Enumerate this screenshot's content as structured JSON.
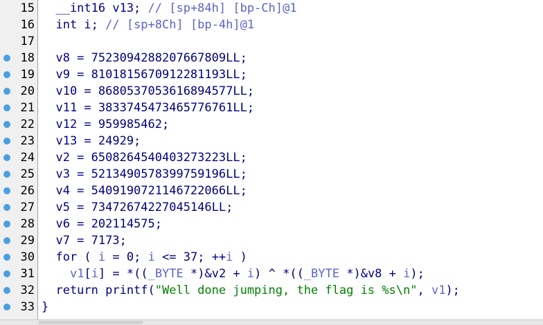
{
  "lines": [
    {
      "n": "15",
      "bp": false,
      "parts": [
        {
          "t": "  __int16 v13; ",
          "c": "k"
        },
        {
          "t": "// [sp+84h] [bp-Ch]@1",
          "c": "c"
        }
      ]
    },
    {
      "n": "16",
      "bp": false,
      "parts": [
        {
          "t": "  int i; ",
          "c": "k"
        },
        {
          "t": "// [sp+8Ch] [bp-4h]@1",
          "c": "c"
        }
      ]
    },
    {
      "n": "17",
      "bp": false,
      "parts": []
    },
    {
      "n": "18",
      "bp": true,
      "parts": [
        {
          "t": "  v8 = 7523094288207667809LL;",
          "c": "k"
        }
      ]
    },
    {
      "n": "19",
      "bp": true,
      "parts": [
        {
          "t": "  v9 = 8101815670912281193LL;",
          "c": "k"
        }
      ]
    },
    {
      "n": "20",
      "bp": true,
      "parts": [
        {
          "t": "  v10 = 8680537053616894577LL;",
          "c": "k"
        }
      ]
    },
    {
      "n": "21",
      "bp": true,
      "parts": [
        {
          "t": "  v11 = 3833745473465776761LL;",
          "c": "k"
        }
      ]
    },
    {
      "n": "22",
      "bp": true,
      "parts": [
        {
          "t": "  v12 = 959985462;",
          "c": "k"
        }
      ]
    },
    {
      "n": "23",
      "bp": true,
      "parts": [
        {
          "t": "  v13 = 24929;",
          "c": "k"
        }
      ]
    },
    {
      "n": "24",
      "bp": true,
      "parts": [
        {
          "t": "  v2 = 6508264540403273223LL;",
          "c": "k"
        }
      ]
    },
    {
      "n": "25",
      "bp": true,
      "parts": [
        {
          "t": "  v3 = 5213490578399759196LL;",
          "c": "k"
        }
      ]
    },
    {
      "n": "26",
      "bp": true,
      "parts": [
        {
          "t": "  v4 = 5409190721146722066LL;",
          "c": "k"
        }
      ]
    },
    {
      "n": "27",
      "bp": true,
      "parts": [
        {
          "t": "  v5 = 73472674227045146LL;",
          "c": "k"
        }
      ]
    },
    {
      "n": "28",
      "bp": true,
      "parts": [
        {
          "t": "  v6 = 202114575;",
          "c": "k"
        }
      ]
    },
    {
      "n": "29",
      "bp": true,
      "parts": [
        {
          "t": "  v7 = 7173;",
          "c": "k"
        }
      ]
    },
    {
      "n": "30",
      "bp": true,
      "parts": [
        {
          "t": "  for ( ",
          "c": "k"
        },
        {
          "t": "i",
          "c": "v"
        },
        {
          "t": " = 0; ",
          "c": "k"
        },
        {
          "t": "i",
          "c": "v"
        },
        {
          "t": " <= 37; ++",
          "c": "k"
        },
        {
          "t": "i",
          "c": "v"
        },
        {
          "t": " )",
          "c": "k"
        }
      ]
    },
    {
      "n": "31",
      "bp": true,
      "parts": [
        {
          "t": "    ",
          "c": "k"
        },
        {
          "t": "v1",
          "c": "v"
        },
        {
          "t": "[",
          "c": "k"
        },
        {
          "t": "i",
          "c": "v"
        },
        {
          "t": "] = *((",
          "c": "k"
        },
        {
          "t": "_BYTE",
          "c": "c"
        },
        {
          "t": " *)&v2 + ",
          "c": "k"
        },
        {
          "t": "i",
          "c": "v"
        },
        {
          "t": ") ^ *((",
          "c": "k"
        },
        {
          "t": "_BYTE",
          "c": "c"
        },
        {
          "t": " *)&v8 + ",
          "c": "k"
        },
        {
          "t": "i",
          "c": "v"
        },
        {
          "t": ");",
          "c": "k"
        }
      ]
    },
    {
      "n": "32",
      "bp": true,
      "parts": [
        {
          "t": "  return printf(",
          "c": "k"
        },
        {
          "t": "\"Well done jumping, the flag is %s\\n\"",
          "c": "s"
        },
        {
          "t": ", ",
          "c": "k"
        },
        {
          "t": "v1",
          "c": "v"
        },
        {
          "t": ");",
          "c": "k"
        }
      ]
    },
    {
      "n": "33",
      "bp": true,
      "parts": [
        {
          "t": "}",
          "c": "k"
        }
      ]
    }
  ],
  "colors": {
    "keyword": "#000080",
    "comment": "#5a64c8",
    "string": "#008000",
    "breakpoint": "#4a9fe0"
  }
}
